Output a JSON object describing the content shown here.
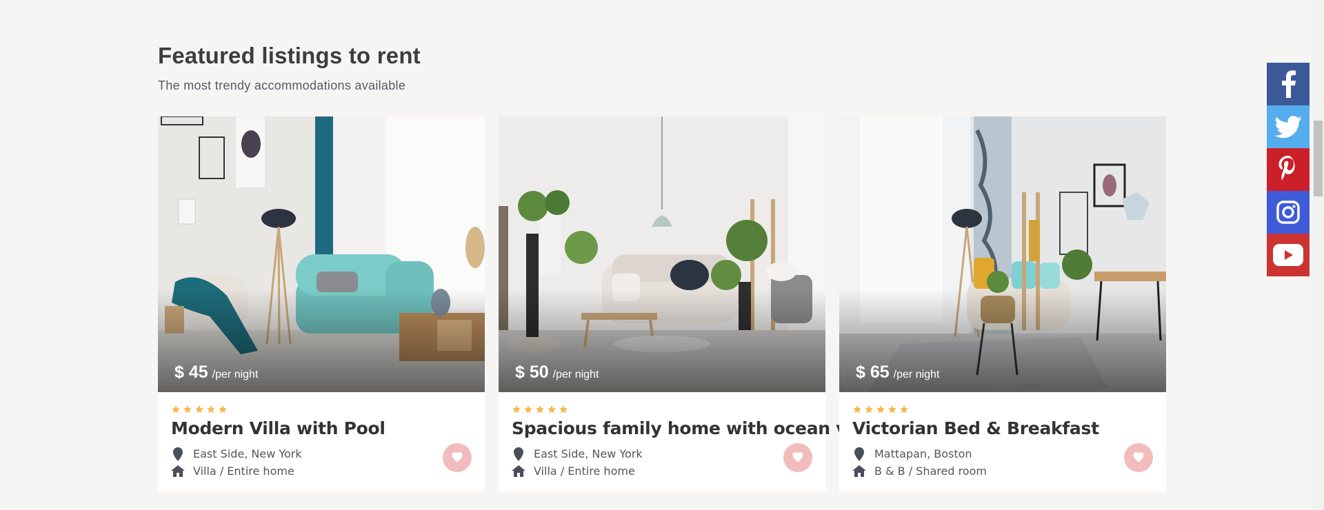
{
  "section": {
    "title": "Featured listings to rent",
    "subtitle": "The most trendy accommodations available"
  },
  "listings": [
    {
      "price": "$ 45",
      "price_unit": "/per night",
      "rating": 5,
      "title": "Modern Villa with Pool",
      "location": "East Side, New York",
      "type": "Villa / Entire home",
      "icons": [
        "map-marker-icon",
        "home-icon",
        "heart-icon",
        "star-icon"
      ]
    },
    {
      "price": "$ 50",
      "price_unit": "/per night",
      "rating": 5,
      "title": "Spacious family home with ocean view",
      "location": "East Side, New York",
      "type": "Villa / Entire home",
      "icons": [
        "map-marker-icon",
        "home-icon",
        "heart-icon",
        "star-icon"
      ]
    },
    {
      "price": "$ 65",
      "price_unit": "/per night",
      "rating": 5,
      "title": "Victorian Bed & Breakfast",
      "location": "Mattapan, Boston",
      "type": "B & B / Shared room",
      "icons": [
        "map-marker-icon",
        "home-icon",
        "heart-icon",
        "star-icon"
      ]
    }
  ],
  "social": [
    {
      "name": "facebook-icon",
      "color": "#3b5998"
    },
    {
      "name": "twitter-icon",
      "color": "#55acee"
    },
    {
      "name": "pinterest-icon",
      "color": "#cb2027"
    },
    {
      "name": "instagram-icon",
      "color": "#3f5bd8"
    },
    {
      "name": "youtube-icon",
      "color": "#cc3333"
    }
  ],
  "colors": {
    "background": "#f6f5f4",
    "star": "#f8b84e",
    "heart_button": "#f2bcbd",
    "meta_icon": "#4a4f5c"
  }
}
